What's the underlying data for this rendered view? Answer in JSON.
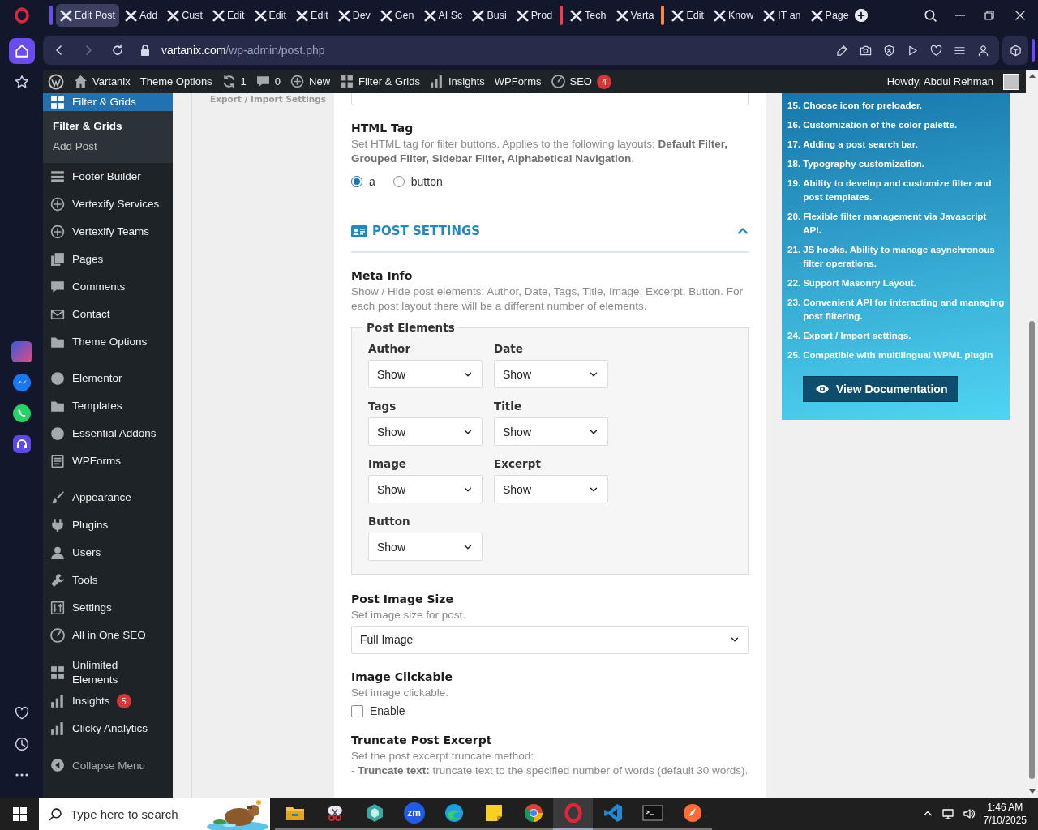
{
  "browser": {
    "tabs": [
      {
        "label": "Edit Post",
        "selected": true,
        "color": "#6a4cf0"
      },
      {
        "label": "Add",
        "selected": false
      },
      {
        "label": "Cust",
        "selected": false
      },
      {
        "label": "Edit",
        "selected": false
      },
      {
        "label": "Edit",
        "selected": false
      },
      {
        "label": "Edit",
        "selected": false
      },
      {
        "label": "Dev",
        "selected": false
      },
      {
        "label": "Gen",
        "selected": false
      },
      {
        "label": "AI Sc",
        "selected": false
      },
      {
        "label": "Busi",
        "selected": false
      },
      {
        "label": "Prod",
        "selected": false
      },
      {
        "label": "Tech",
        "selected": false,
        "color": "#e0455a"
      },
      {
        "label": "Varta",
        "selected": false
      },
      {
        "label": "Edit",
        "selected": false,
        "color": "#f08a4b"
      },
      {
        "label": "Know",
        "selected": false
      },
      {
        "label": "IT an",
        "selected": false
      },
      {
        "label": "Page",
        "selected": false
      }
    ],
    "url": {
      "host": "vartanix.com",
      "path": "/wp-admin/post.php"
    }
  },
  "admin_bar": {
    "items": [
      {
        "label": "Vartanix"
      },
      {
        "label": "Theme Options"
      },
      {
        "label": "1"
      },
      {
        "label": "0"
      },
      {
        "label": "New"
      },
      {
        "label": "Filter & Grids"
      },
      {
        "label": "Insights"
      },
      {
        "label": "WPForms"
      },
      {
        "label": "SEO",
        "badge": "4"
      }
    ],
    "greeting": "Howdy, Abdul Rehman"
  },
  "admin_menu": {
    "groups": [
      {
        "items": [
          {
            "label": "Filter & Grids",
            "selected": true,
            "children": [
              {
                "label": "Filter & Grids",
                "selected": true
              },
              {
                "label": "Add Post",
                "selected": false
              }
            ]
          },
          {
            "label": "Footer Builder",
            "selected": false
          },
          {
            "label": "Vertexify Services",
            "selected": false
          },
          {
            "label": "Vertexify Teams",
            "selected": false
          },
          {
            "label": "Pages",
            "selected": false
          },
          {
            "label": "Comments",
            "selected": false
          },
          {
            "label": "Contact",
            "selected": false
          },
          {
            "label": "Theme Options",
            "selected": false
          }
        ]
      },
      {
        "items": [
          {
            "label": "Elementor",
            "selected": false
          },
          {
            "label": "Templates",
            "selected": false
          },
          {
            "label": "Essential Addons",
            "selected": false
          },
          {
            "label": "WPForms",
            "selected": false
          }
        ]
      },
      {
        "items": [
          {
            "label": "Appearance",
            "selected": false
          },
          {
            "label": "Plugins",
            "selected": false
          },
          {
            "label": "Users",
            "selected": false
          },
          {
            "label": "Tools",
            "selected": false
          },
          {
            "label": "Settings",
            "selected": false
          },
          {
            "label": "All in One SEO",
            "selected": false
          }
        ]
      },
      {
        "items": [
          {
            "label": "Unlimited Elements",
            "selected": false
          },
          {
            "label": "Insights",
            "selected": false,
            "badge": "5"
          },
          {
            "label": "Clicky Analytics",
            "selected": false
          }
        ]
      }
    ],
    "collapse": "Collapse Menu"
  },
  "side_link": "Export / Import Settings",
  "form": {
    "html_tag": {
      "title": "HTML Tag",
      "description": "Set HTML tag for filter buttons. Applies to the following layouts: **Default Filter, Grouped Filter, Sidebar Filter, Alphabetical Navigation**.",
      "options": [
        {
          "label": "a",
          "selected": true
        },
        {
          "label": "button",
          "selected": false
        }
      ]
    },
    "section": {
      "title": "POST SETTINGS",
      "expanded": true
    },
    "meta_info": {
      "title": "Meta Info",
      "description": "Show / Hide post elements: Author, Date, Tags, Title, Image, Excerpt, Button. For each post layout there will be a different number of elements.",
      "legend": "Post Elements",
      "fields": [
        {
          "label": "Author",
          "value": "Show"
        },
        {
          "label": "Date",
          "value": "Show"
        },
        {
          "label": "Tags",
          "value": "Show"
        },
        {
          "label": "Title",
          "value": "Show"
        },
        {
          "label": "Image",
          "value": "Show"
        },
        {
          "label": "Excerpt",
          "value": "Show"
        },
        {
          "label": "Button",
          "value": "Show"
        }
      ]
    },
    "image_size": {
      "title": "Post Image Size",
      "description": "Set image size for post.",
      "value": "Full Image"
    },
    "clickable": {
      "title": "Image Clickable",
      "description": "Set image clickable.",
      "option": {
        "label": "Enable",
        "checked": false
      }
    },
    "truncate": {
      "title": "Truncate Post Excerpt",
      "lines": [
        "Set the post excerpt truncate method:",
        "- **Truncate text:** truncate text to the specified number of words (default 30 words)."
      ]
    }
  },
  "features": {
    "items": [
      {
        "number": "15.",
        "text": "Choose icon for preloader."
      },
      {
        "number": "16.",
        "text": "Customization of the color palette."
      },
      {
        "number": "17.",
        "text": "Adding a post search bar."
      },
      {
        "number": "18.",
        "text": "Typography customization."
      },
      {
        "number": "19.",
        "text": "Ability to develop and customize filter and post templates."
      },
      {
        "number": "20.",
        "text": "Flexible filter management via Javascript API."
      },
      {
        "number": "21.",
        "text": "JS hooks. Ability to manage asynchronous filter operations."
      },
      {
        "number": "22.",
        "text": "Support Masonry Layout."
      },
      {
        "number": "23.",
        "text": "Convenient API for interacting and managing post filtering."
      },
      {
        "number": "24.",
        "text": "Export / Import settings."
      },
      {
        "number": "25.",
        "text": "Compatible with multilingual WPML plugin"
      }
    ],
    "button": "View Documentation"
  },
  "taskbar": {
    "search_placeholder": "Type here to search",
    "apps": [
      {
        "selected": false
      },
      {
        "selected": false
      },
      {
        "selected": false
      },
      {
        "selected": false,
        "label": "zm"
      },
      {
        "selected": false
      },
      {
        "selected": false
      },
      {
        "selected": false
      },
      {
        "selected": true
      },
      {
        "selected": false
      },
      {
        "selected": false
      },
      {
        "selected": false
      }
    ],
    "time": "1:46 AM",
    "date": "7/10/2025"
  }
}
